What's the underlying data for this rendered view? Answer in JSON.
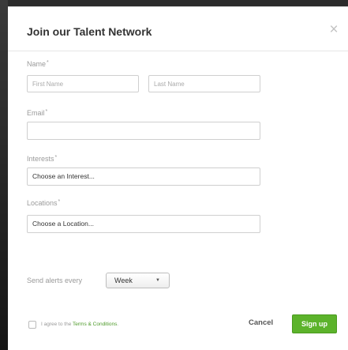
{
  "modal": {
    "title": "Join our Talent Network",
    "close_glyph": "×"
  },
  "form": {
    "required_marker": "*",
    "name": {
      "label": "Name",
      "first_placeholder": "First Name",
      "last_placeholder": "Last Name"
    },
    "email": {
      "label": "Email",
      "value": ""
    },
    "interests": {
      "label": "Interests",
      "placeholder": "Choose an Interest..."
    },
    "locations": {
      "label": "Locations",
      "placeholder": "Choose a Location..."
    },
    "alerts": {
      "label": "Send alerts every",
      "selected": "Week",
      "arrow": "▼"
    }
  },
  "footer": {
    "agree_prefix": "I agree to the ",
    "terms_link": "Terms & Conditions",
    "agree_suffix": ".",
    "agree_checked": false,
    "cancel_label": "Cancel",
    "signup_label": "Sign up"
  },
  "colors": {
    "accent_green": "#5cb32b",
    "link_green": "#4d9a2a",
    "label_gray": "#9a9a9a"
  },
  "icons": {
    "close": "close-icon",
    "dropdown": "chevron-down-icon"
  }
}
